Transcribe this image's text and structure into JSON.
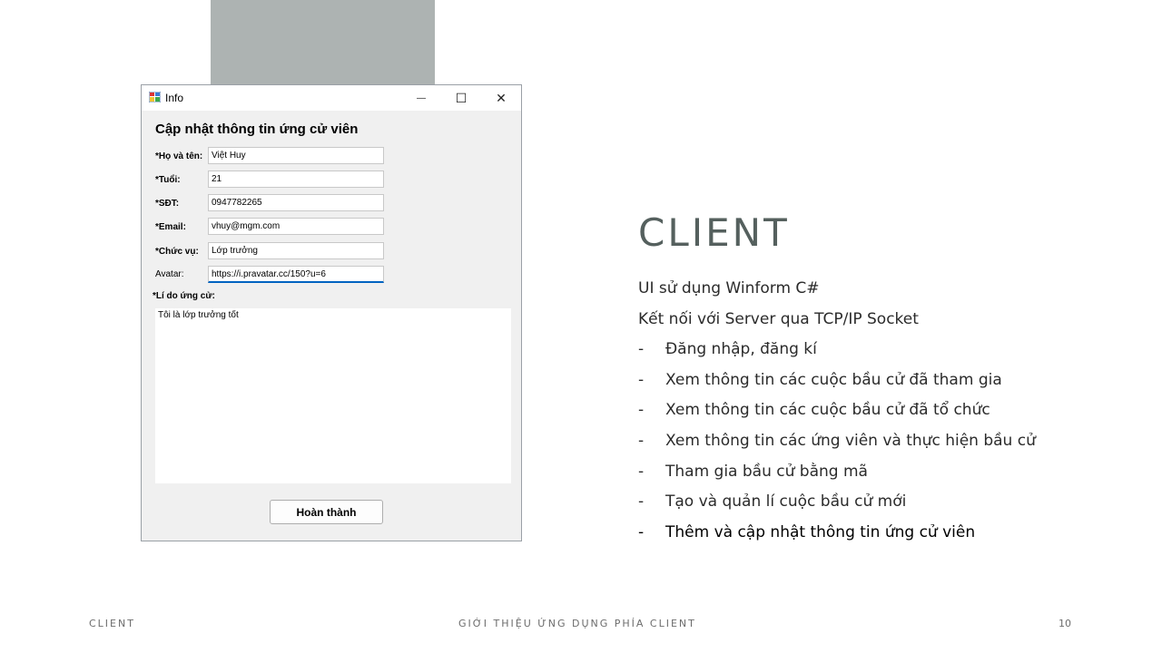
{
  "window": {
    "title": "Info",
    "heading": "Cập nhật thông tin ứng cử viên",
    "fields": [
      {
        "label": "*Họ và tên:",
        "value": "Việt Huy"
      },
      {
        "label": "*Tuổi:",
        "value": "21"
      },
      {
        "label": "*SĐT:",
        "value": "0947782265"
      },
      {
        "label": "*Email:",
        "value": "vhuy@mgm.com"
      },
      {
        "label": "*Chức vụ:",
        "value": "Lớp trưởng"
      },
      {
        "label": "Avatar:",
        "value": "https://i.pravatar.cc/150?u=6"
      }
    ],
    "reason_label": "*Lí do ứng cử:",
    "reason_value": "Tôi là lớp trưởng tốt",
    "finish_button": "Hoàn thành",
    "controls": {
      "minimize": "—",
      "maximize": "☐",
      "close": "✕"
    }
  },
  "slide": {
    "title": "CLIENT",
    "lines": [
      "UI sử dụng Winform C#",
      "Kết nối với Server qua TCP/IP Socket"
    ],
    "bullets": [
      "Đăng nhập, đăng kí",
      "Xem thông tin các cuộc bầu cử đã tham gia",
      "Xem thông tin các cuộc bầu cử đã tổ chức",
      "Xem thông tin các ứng viên và thực hiện bầu cử",
      "Tham gia bầu cử bằng mã",
      "Tạo và quản lí cuộc bầu cử mới",
      "Thêm và cập nhật thông tin ứng cử viên"
    ],
    "bullet_dash": "-"
  },
  "footer": {
    "left": "CLIENT",
    "center": "GIỚI THIỆU ỨNG DỤNG PHÍA CLIENT",
    "page": "10"
  }
}
